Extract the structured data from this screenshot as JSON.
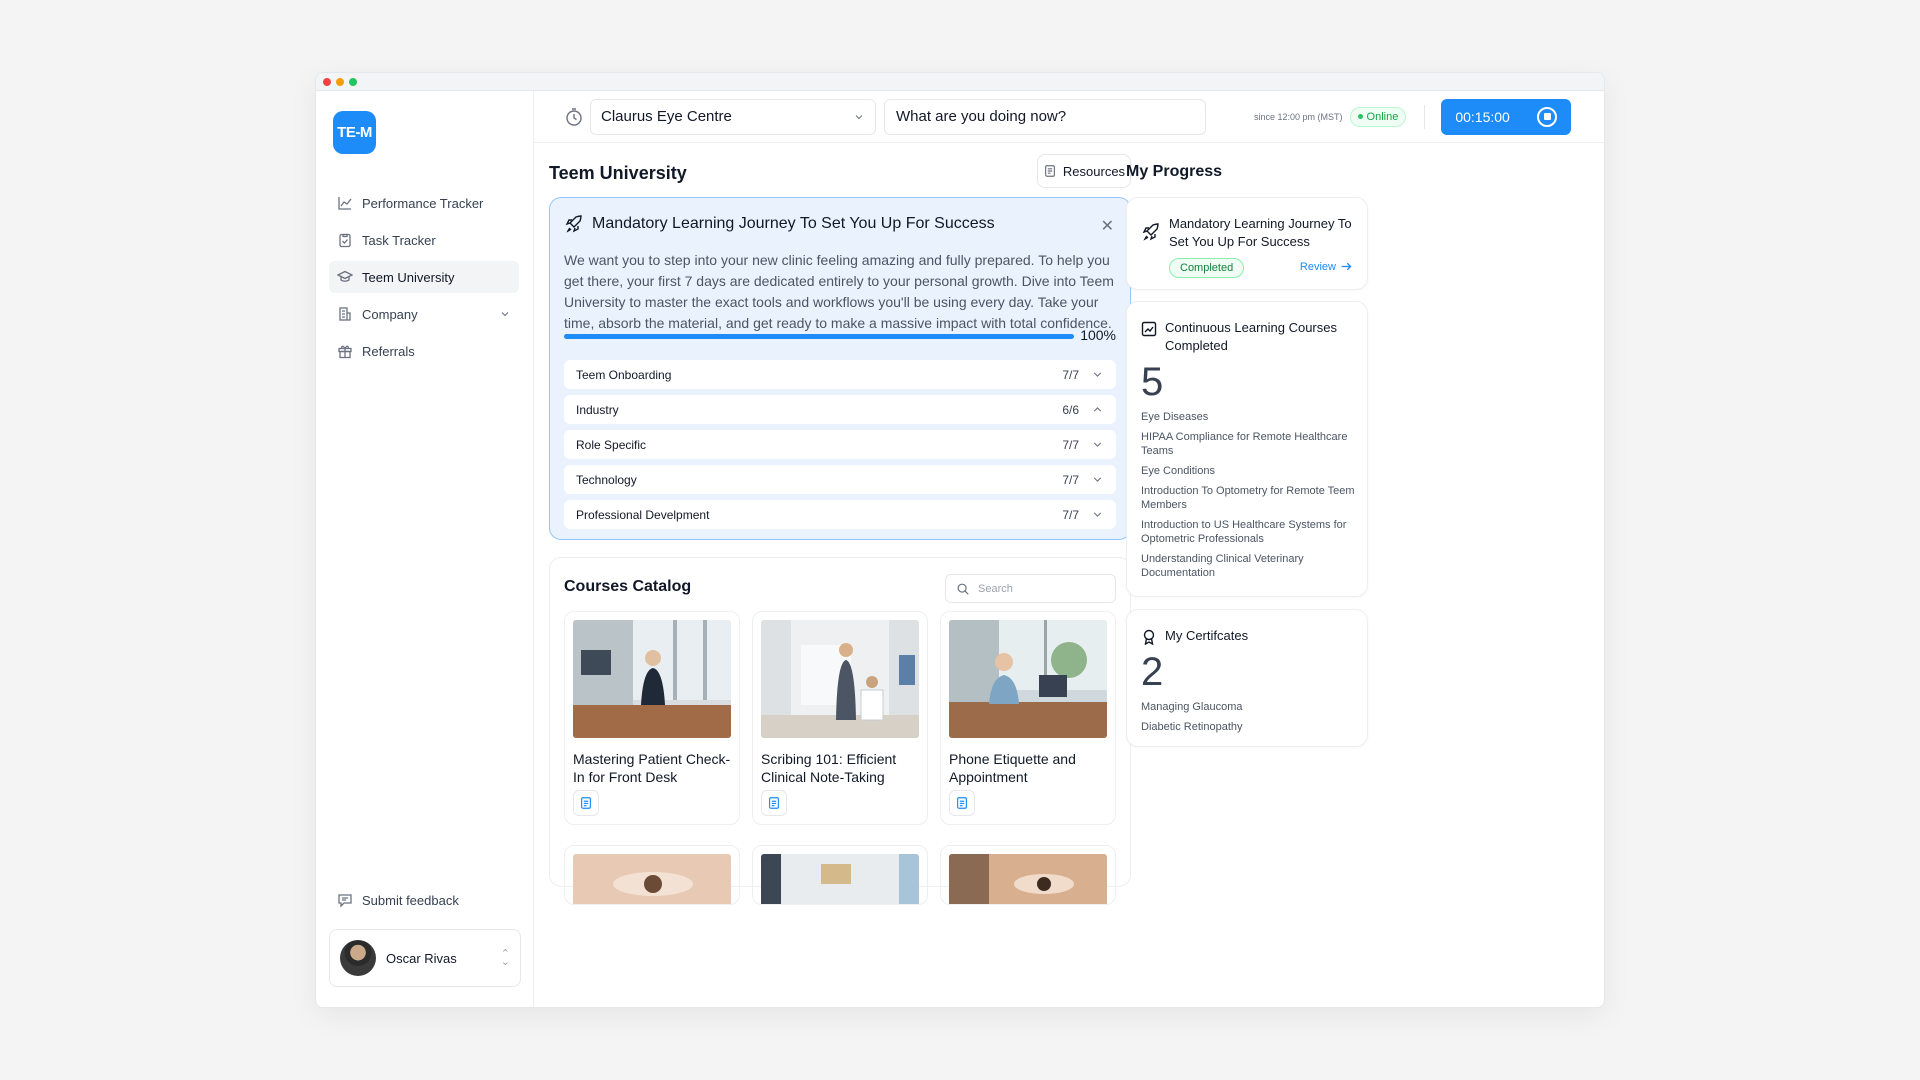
{
  "sidebar": {
    "logo": "TE-M",
    "items": [
      {
        "label": "Performance Tracker",
        "icon": "chart-line-icon"
      },
      {
        "label": "Task Tracker",
        "icon": "clipboard-icon"
      },
      {
        "label": "Teem University",
        "icon": "graduation-cap-icon",
        "active": true
      },
      {
        "label": "Company",
        "icon": "building-icon",
        "expandable": true
      },
      {
        "label": "Referrals",
        "icon": "gift-icon"
      }
    ],
    "feedback_label": "Submit feedback",
    "user_name": "Oscar Rivas"
  },
  "topbar": {
    "clinic": "Claurus Eye Centre",
    "doing": "What are you doing now?",
    "since": "since 12:00 pm (MST)",
    "status": "Online",
    "timer": "00:15:00"
  },
  "main": {
    "title": "Teem University",
    "resources_label": "Resources",
    "journey": {
      "title": "Mandatory Learning Journey To Set You Up For Success",
      "description": "We want you to step into your new clinic feeling amazing and fully prepared. To help you get there, your first 7 days are dedicated entirely to your personal growth. Dive into Teem University to master the exact tools and workflows you'll be using every day. Take your time, absorb the material, and get ready to make a massive impact with total confidence.",
      "progress": 100,
      "progress_label": "100%",
      "modules": [
        {
          "name": "Teem Onboarding",
          "count": "7/7",
          "expanded": false
        },
        {
          "name": "Industry",
          "count": "6/6",
          "expanded": true
        },
        {
          "name": "Role Specific",
          "count": "7/7",
          "expanded": false
        },
        {
          "name": "Technology",
          "count": "7/7",
          "expanded": false
        },
        {
          "name": "Professional Develpment",
          "count": "7/7",
          "expanded": false
        }
      ]
    },
    "catalog": {
      "title": "Courses Catalog",
      "search_placeholder": "Search",
      "courses": [
        {
          "title": "Mastering Patient Check-In for Front Desk Excellence"
        },
        {
          "title": "Scribing 101: Efficient Clinical Note-Taking"
        },
        {
          "title": "Phone Etiquette and Appointment Scheduling…"
        }
      ]
    }
  },
  "progress": {
    "title": "My Progress",
    "journey_card": {
      "title": "Mandatory Learning Journey To Set You Up For Success",
      "status": "Completed",
      "review_label": "Review"
    },
    "continuous": {
      "title": "Continuous Learning Courses Completed",
      "count": "5",
      "courses": [
        "Eye Diseases",
        "HIPAA Compliance for Remote Healthcare Teams",
        "Eye Conditions",
        "Introduction To Optometry for Remote Teem Members",
        "Introduction to US Healthcare Systems for Optometric Professionals",
        "Understanding Clinical Veterinary Documentation"
      ]
    },
    "certificates": {
      "title": "My Certifcates",
      "count": "2",
      "items": [
        "Managing Glaucoma",
        "Diabetic Retinopathy"
      ]
    }
  },
  "colors": {
    "accent": "#1d8cf8",
    "success": "#16a34a",
    "journey_bg": "#eaf3fd"
  }
}
